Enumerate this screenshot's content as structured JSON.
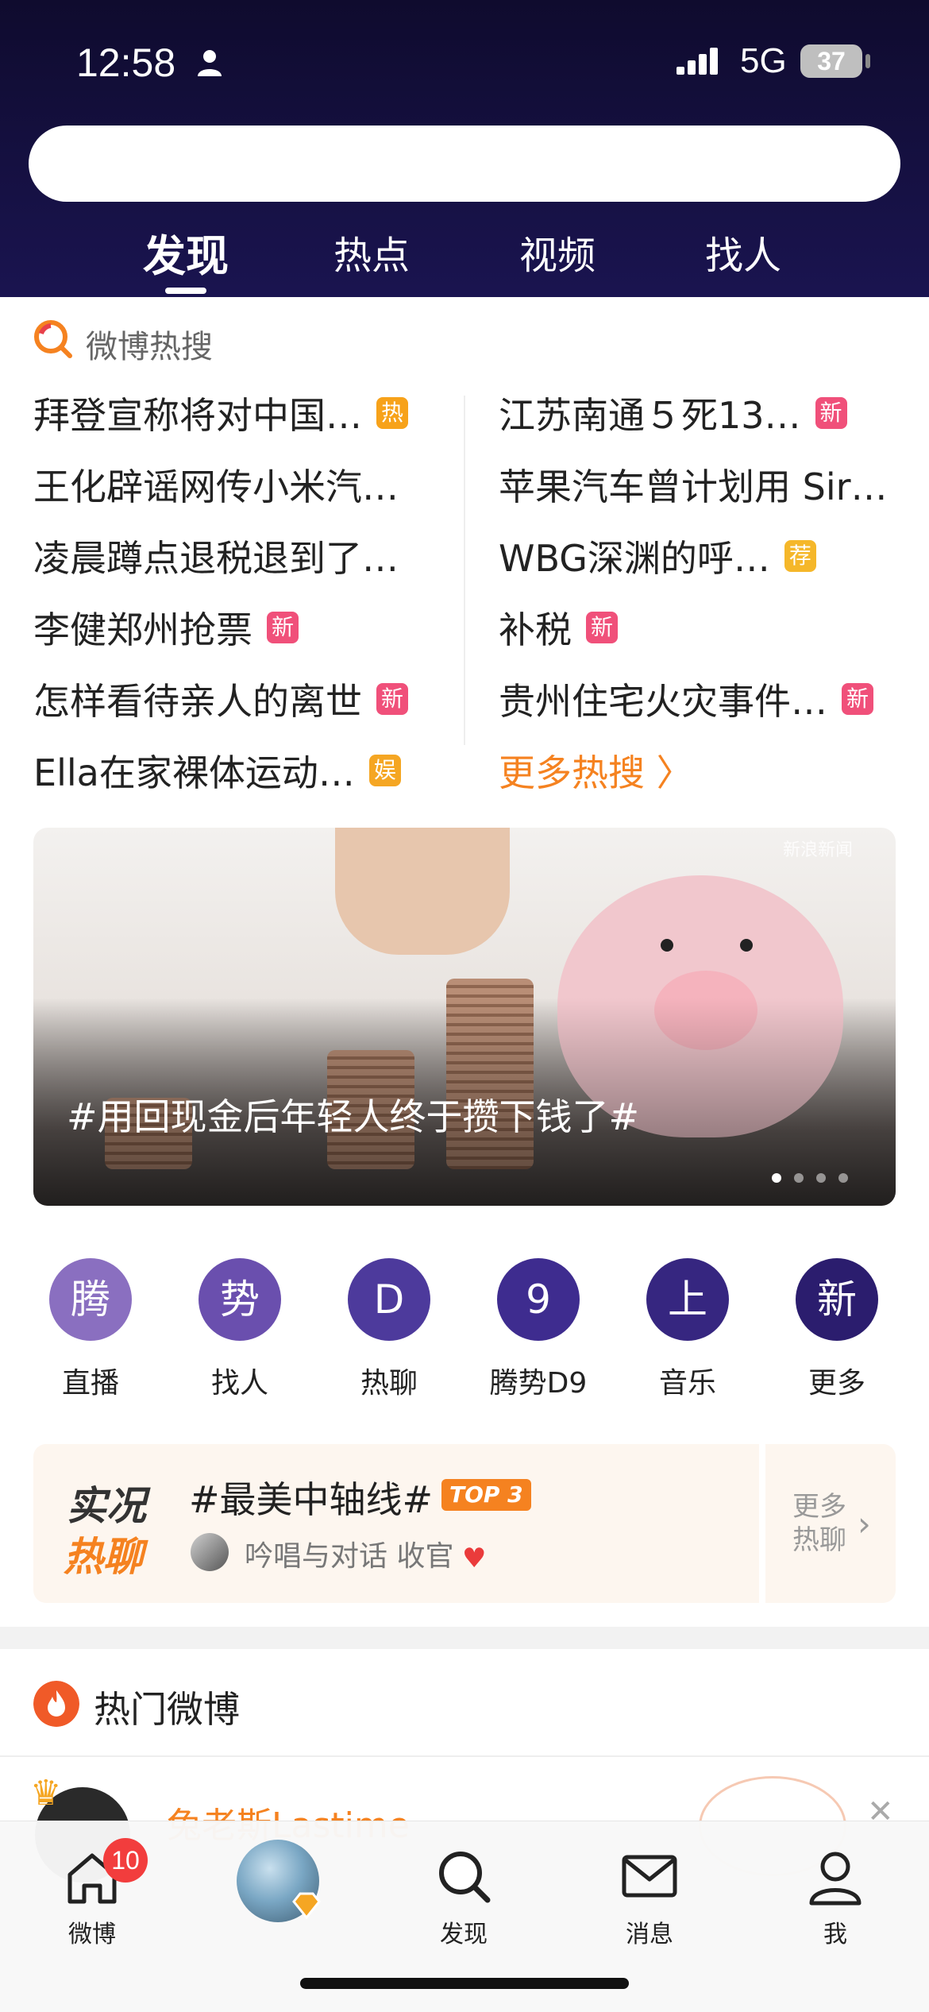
{
  "status_bar": {
    "time": "12:58",
    "network": "5G",
    "battery": "37"
  },
  "search": {
    "placeholder": ""
  },
  "top_tabs": [
    {
      "label": "发现",
      "active": true
    },
    {
      "label": "热点"
    },
    {
      "label": "视频"
    },
    {
      "label": "找人"
    }
  ],
  "hot_search": {
    "title": "微博热搜",
    "left": [
      {
        "text": "拜登宣称将对中国…",
        "badge": "热"
      },
      {
        "text": "王化辟谣网传小米汽…",
        "badge": ""
      },
      {
        "text": "凌晨蹲点退税退到了…",
        "badge": ""
      },
      {
        "text": "李健郑州抢票",
        "badge": "新"
      },
      {
        "text": "怎样看待亲人的离世",
        "badge": "新"
      },
      {
        "text": "Ella在家裸体运动…",
        "badge": "娱"
      }
    ],
    "right": [
      {
        "text": "江苏南通５死13…",
        "badge": "新"
      },
      {
        "text": "苹果汽车曾计划用 Sir…",
        "badge": ""
      },
      {
        "text": "WBG深渊的呼…",
        "badge": "荐"
      },
      {
        "text": "补税",
        "badge": "新"
      },
      {
        "text": "贵州住宅火灾事件…",
        "badge": "新"
      }
    ],
    "more": "更多热搜 〉"
  },
  "banner": {
    "caption": "#用回现金后年轻人终于攒下钱了#",
    "source": "新浪新闻"
  },
  "shortcuts": [
    {
      "glyph": "腾",
      "label": "直播",
      "color": "#8a6fc0"
    },
    {
      "glyph": "势",
      "label": "找人",
      "color": "#6a4fae"
    },
    {
      "glyph": "D",
      "label": "热聊",
      "color": "#4d3a9c"
    },
    {
      "glyph": "9",
      "label": "腾势D9",
      "color": "#3e2c8f"
    },
    {
      "glyph": "上",
      "label": "音乐",
      "color": "#362680"
    },
    {
      "glyph": "新",
      "label": "更多",
      "color": "#2b1d6e"
    }
  ],
  "live_talk": {
    "logo_line1": "实况",
    "logo_line2": "热聊",
    "topic": "#最美中轴线#",
    "rank": "TOP 3",
    "sub": "吟唱与对话 收官",
    "more": "更多\n热聊"
  },
  "hot_weibo": {
    "title": "热门微博"
  },
  "peek_post": {
    "name": "兔老斯Lastime"
  },
  "bottom_nav": {
    "home": "微博",
    "home_badge": "10",
    "discover": "发现",
    "messages": "消息",
    "me": "我"
  }
}
